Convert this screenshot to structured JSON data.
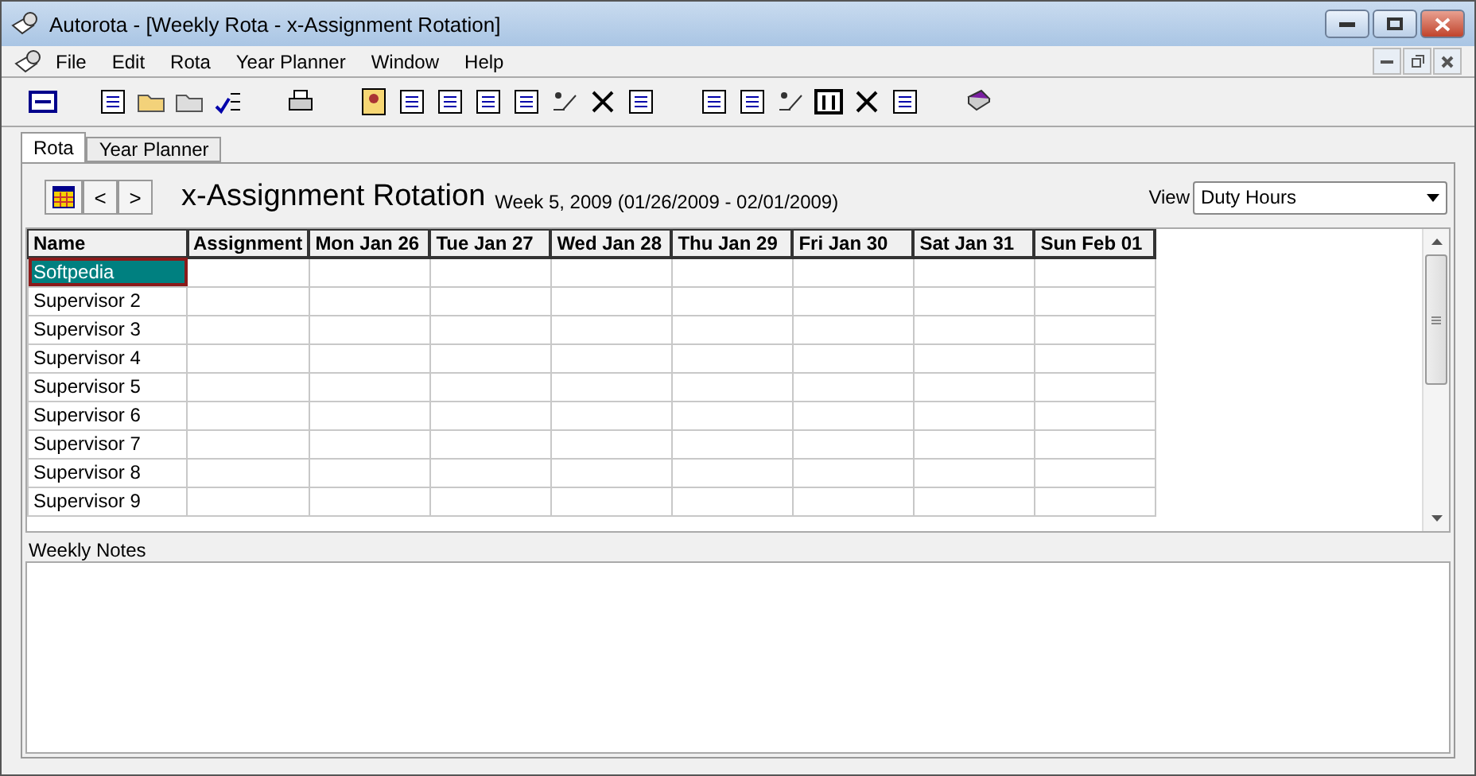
{
  "window": {
    "title": "Autorota - [Weekly Rota - x-Assignment Rotation]"
  },
  "menu": [
    "File",
    "Edit",
    "Rota",
    "Year Planner",
    "Window",
    "Help"
  ],
  "tabs": [
    {
      "label": "Rota",
      "selected": true
    },
    {
      "label": "Year Planner",
      "selected": false
    }
  ],
  "header": {
    "title": "x-Assignment Rotation",
    "week": "Week 5, 2009 (01/26/2009 - 02/01/2009)",
    "nav_prev": "<",
    "nav_next": ">",
    "view_label": "View",
    "view_value": "Duty Hours"
  },
  "table": {
    "columns": [
      "Name",
      "Assignment",
      "Mon Jan 26",
      "Tue Jan 27",
      "Wed Jan 28",
      "Thu Jan 29",
      "Fri Jan 30",
      "Sat Jan 31",
      "Sun Feb 01"
    ],
    "rows": [
      {
        "name": "Softpedia",
        "selected": true
      },
      {
        "name": "Supervisor 2",
        "selected": false
      },
      {
        "name": "Supervisor 3",
        "selected": false
      },
      {
        "name": "Supervisor 4",
        "selected": false
      },
      {
        "name": "Supervisor 5",
        "selected": false
      },
      {
        "name": "Supervisor 6",
        "selected": false
      },
      {
        "name": "Supervisor 7",
        "selected": false
      },
      {
        "name": "Supervisor 8",
        "selected": false
      },
      {
        "name": "Supervisor 9",
        "selected": false
      }
    ]
  },
  "notes": {
    "label": "Weekly Notes"
  }
}
